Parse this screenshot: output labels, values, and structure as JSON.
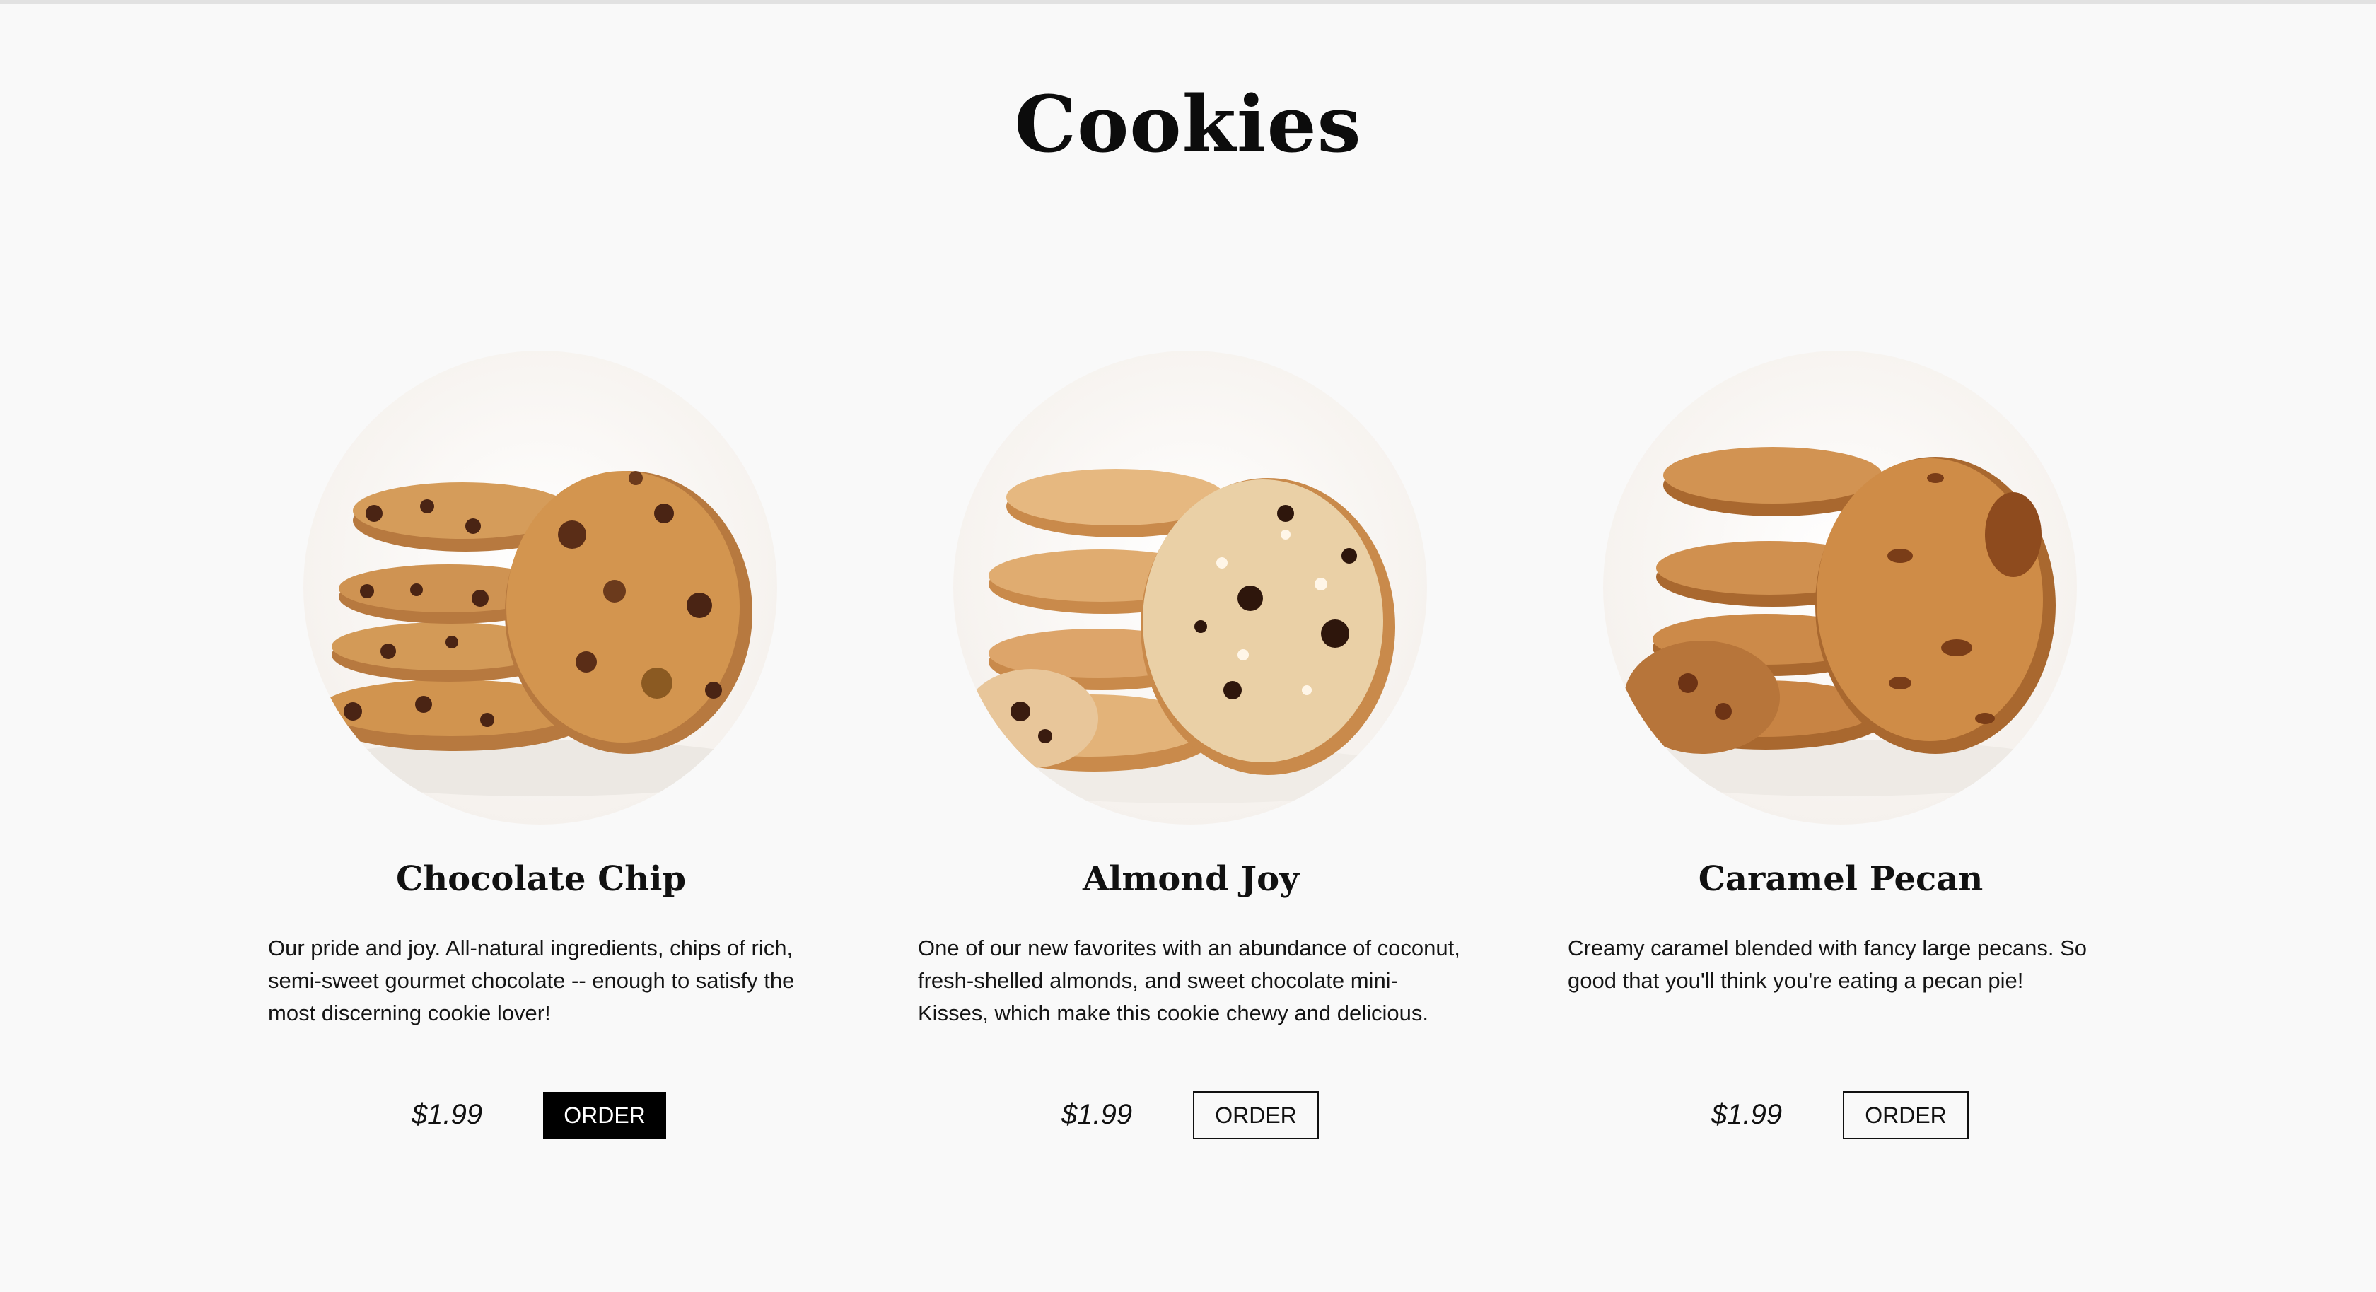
{
  "page": {
    "title": "Cookies"
  },
  "products": [
    {
      "name": "Chocolate Chip",
      "description": "Our pride and joy. All-natural ingredients, chips of rich, semi-sweet gourmet chocolate -- enough to satisfy the most discerning cookie lover!",
      "price": "$1.99",
      "order_label": "ORDER",
      "order_style": "filled"
    },
    {
      "name": "Almond Joy",
      "description": "One of our new favorites with an abundance of coconut, fresh-shelled almonds, and sweet chocolate mini-Kisses, which make this cookie chewy and delicious.",
      "price": "$1.99",
      "order_label": "ORDER",
      "order_style": "outline"
    },
    {
      "name": "Caramel Pecan",
      "description": "Creamy caramel blended with fancy large pecans. So good that you'll think you're eating a pecan pie!",
      "price": "$1.99",
      "order_label": "ORDER",
      "order_style": "outline"
    }
  ],
  "colors": {
    "background": "#f9f9f9",
    "text": "#111111",
    "button_filled": "#000000",
    "cookie_dough": "#c8874a",
    "chocolate": "#4a2414"
  }
}
